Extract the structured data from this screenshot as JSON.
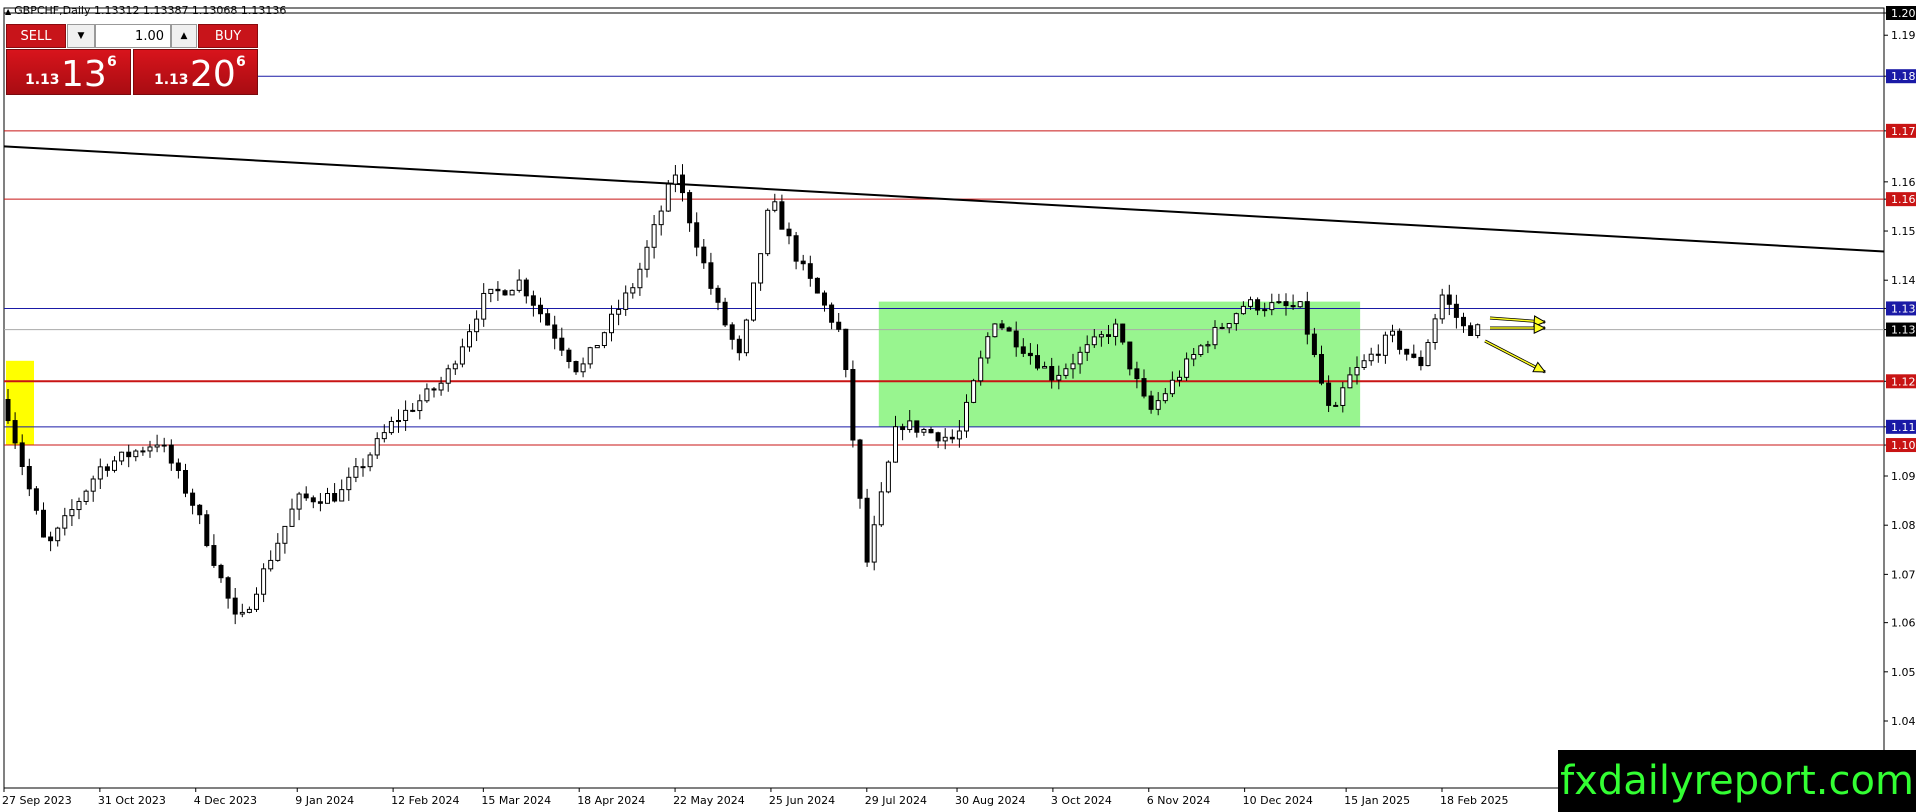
{
  "header": {
    "symbol_info": "GBPCHF,Daily  1.13312 1.13387 1.13068 1.13136"
  },
  "trade_panel": {
    "sell_label": "SELL",
    "buy_label": "BUY",
    "lot_value": "1.00",
    "sell_price": {
      "prefix": "1.13",
      "big": "13",
      "sup": "6"
    },
    "buy_price": {
      "prefix": "1.13",
      "big": "20",
      "sup": "6"
    }
  },
  "watermark": "fxdailyreport.com",
  "colors": {
    "candle": "#000000",
    "box": "#98f58f",
    "support_blue": "#1a1aa6",
    "resistance_red": "#c81414",
    "arrow_yellow": "#ffff22",
    "highlight_yellow": "#ffff00"
  },
  "chart_data": {
    "type": "candlestick",
    "symbol": "GBPCHF",
    "timeframe": "Daily",
    "last_price": 1.13136,
    "ylim": [
      1.0355,
      1.20088
    ],
    "y_ticks": [
      "1.20088",
      "1.19600",
      "1.18700",
      "1.17500",
      "1.16380",
      "1.16000",
      "1.15300",
      "1.14220",
      "1.13600",
      "1.13136",
      "1.12000",
      "1.11000",
      "1.10600",
      "1.09920",
      "1.08840",
      "1.07760",
      "1.06700",
      "1.05620",
      "1.04540"
    ],
    "x_ticks": [
      "27 Sep 2023",
      "31 Oct 2023",
      "4 Dec 2023",
      "9 Jan 2024",
      "12 Feb 2024",
      "15 Mar 2024",
      "18 Apr 2024",
      "22 May 2024",
      "25 Jun 2024",
      "29 Jul 2024",
      "30 Aug 2024",
      "3 Oct 2024",
      "6 Nov 2024",
      "10 Dec 2024",
      "15 Jan 2025",
      "18 Feb 2025"
    ],
    "horizontal_levels": [
      {
        "price": 1.187,
        "label": "1.18700",
        "color": "blue"
      },
      {
        "price": 1.175,
        "label": "1.17500",
        "color": "red"
      },
      {
        "price": 1.16,
        "label": "1.16000",
        "color": "red"
      },
      {
        "price": 1.136,
        "label": "1.13600",
        "color": "blue"
      },
      {
        "price": 1.12,
        "label": "1.12000",
        "color": "red"
      },
      {
        "price": 1.11,
        "label": "1.11000",
        "color": "blue"
      },
      {
        "price": 1.106,
        "label": "1.10600",
        "color": "red"
      }
    ],
    "trendline": {
      "from_price": 1.1716,
      "to_price": 1.1485
    },
    "range_box": {
      "from": "29 Jul 2024",
      "to": "15 Jan 2025",
      "high": 1.1375,
      "low": 1.11
    },
    "key_points": [
      {
        "date": "27 Sep 2023",
        "price": 1.116
      },
      {
        "date": "12 Oct 2023",
        "price": 1.083
      },
      {
        "date": "31 Oct 2023",
        "price": 1.101
      },
      {
        "date": "21 Nov 2023",
        "price": 1.107
      },
      {
        "date": "4 Dec 2023",
        "price": 1.092
      },
      {
        "date": "19 Dec 2023",
        "price": 1.066
      },
      {
        "date": "9 Jan 2024",
        "price": 1.094
      },
      {
        "date": "24 Jan 2024",
        "price": 1.095
      },
      {
        "date": "12 Feb 2024",
        "price": 1.111
      },
      {
        "date": "1 Mar 2024",
        "price": 1.12
      },
      {
        "date": "15 Mar 2024",
        "price": 1.138
      },
      {
        "date": "28 Mar 2024",
        "price": 1.142
      },
      {
        "date": "18 Apr 2024",
        "price": 1.122
      },
      {
        "date": "8 May 2024",
        "price": 1.142
      },
      {
        "date": "22 May 2024",
        "price": 1.166
      },
      {
        "date": "5 Jun 2024",
        "price": 1.138
      },
      {
        "date": "14 Jun 2024",
        "price": 1.125
      },
      {
        "date": "25 Jun 2024",
        "price": 1.16
      },
      {
        "date": "5 Jul 2024",
        "price": 1.146
      },
      {
        "date": "20 Jul 2024",
        "price": 1.13
      },
      {
        "date": "29 Jul 2024",
        "price": 1.08
      },
      {
        "date": "9 Aug 2024",
        "price": 1.111
      },
      {
        "date": "30 Aug 2024",
        "price": 1.107
      },
      {
        "date": "12 Sep 2024",
        "price": 1.134
      },
      {
        "date": "3 Oct 2024",
        "price": 1.121
      },
      {
        "date": "25 Oct 2024",
        "price": 1.132
      },
      {
        "date": "6 Nov 2024",
        "price": 1.113
      },
      {
        "date": "25 Nov 2024",
        "price": 1.128
      },
      {
        "date": "10 Dec 2024",
        "price": 1.137
      },
      {
        "date": "30 Dec 2024",
        "price": 1.136
      },
      {
        "date": "10 Jan 2025",
        "price": 1.111
      },
      {
        "date": "15 Jan 2025",
        "price": 1.12
      },
      {
        "date": "31 Jan 2025",
        "price": 1.13
      },
      {
        "date": "10 Feb 2025",
        "price": 1.123
      },
      {
        "date": "18 Feb 2025",
        "price": 1.139
      },
      {
        "date": "26 Feb 2025",
        "price": 1.1314
      }
    ]
  }
}
